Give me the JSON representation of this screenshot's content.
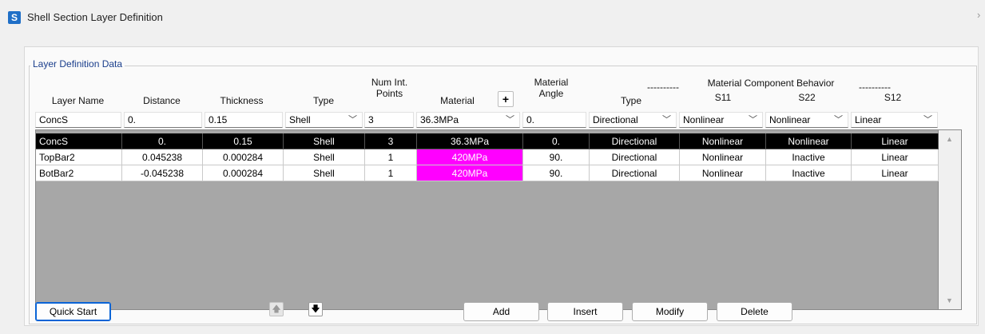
{
  "window": {
    "title": "Shell Section Layer Definition",
    "icon_letter": "S"
  },
  "group": {
    "legend": "Layer Definition Data"
  },
  "headers": {
    "layer_name": "Layer Name",
    "distance": "Distance",
    "thickness": "Thickness",
    "type": "Type",
    "num_int_line1": "Num Int.",
    "num_int_line2": "Points",
    "material": "Material",
    "material_angle_line1": "Material",
    "material_angle_line2": "Angle",
    "behavior_dashes": "----------",
    "behavior_title": "Material  Component  Behavior",
    "behavior_type": "Type",
    "s11": "S11",
    "s22": "S22",
    "s12": "S12",
    "plus": "+"
  },
  "edit_row": {
    "layer_name": "ConcS",
    "distance": "0.",
    "thickness": "0.15",
    "type": "Shell",
    "num_int": "3",
    "material": "36.3MPa",
    "material_angle": "0.",
    "behavior_type": "Directional",
    "s11": "Nonlinear",
    "s22": "Nonlinear",
    "s12": "Linear"
  },
  "rows": [
    {
      "layer_name": "ConcS",
      "distance": "0.",
      "thickness": "0.15",
      "type": "Shell",
      "num_int": "3",
      "material": "36.3MPa",
      "material_angle": "0.",
      "behavior_type": "Directional",
      "s11": "Nonlinear",
      "s22": "Nonlinear",
      "s12": "Linear"
    },
    {
      "layer_name": "TopBar2",
      "distance": "0.045238",
      "thickness": "0.000284",
      "type": "Shell",
      "num_int": "1",
      "material": "420MPa",
      "material_angle": "90.",
      "behavior_type": "Directional",
      "s11": "Nonlinear",
      "s22": "Inactive",
      "s12": "Linear"
    },
    {
      "layer_name": "BotBar2",
      "distance": "-0.045238",
      "thickness": "0.000284",
      "type": "Shell",
      "num_int": "1",
      "material": "420MPa",
      "material_angle": "90.",
      "behavior_type": "Directional",
      "s11": "Nonlinear",
      "s22": "Inactive",
      "s12": "Linear"
    }
  ],
  "buttons": {
    "quick_start": "Quick Start",
    "add": "Add",
    "insert": "Insert",
    "modify": "Modify",
    "delete": "Delete",
    "move_up": "🡅",
    "move_down": "🡇"
  },
  "colors": {
    "selected_row": "#000000",
    "material_highlight": "#ff00ff",
    "accent": "#0a64d6"
  }
}
